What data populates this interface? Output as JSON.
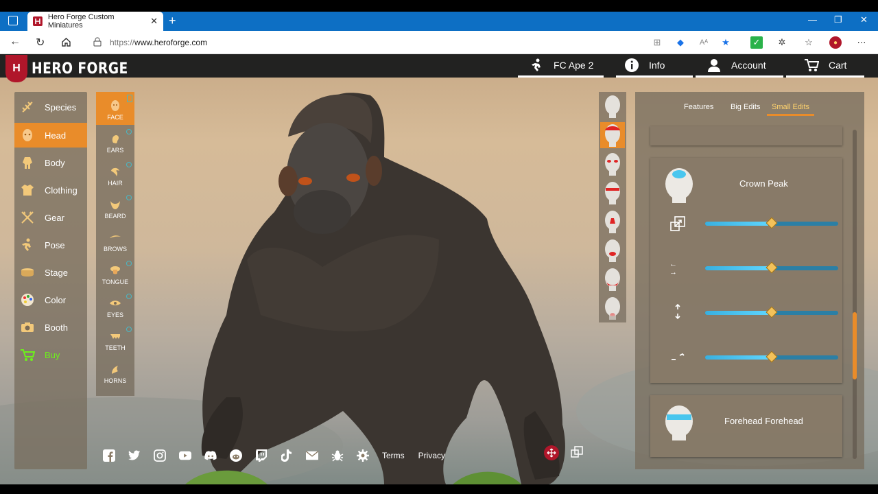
{
  "browser": {
    "tab_title": "Hero Forge Custom Miniatures",
    "new_tab": "+",
    "url_prefix": "https://",
    "url_domain": "www.heroforge.com",
    "minimize": "—",
    "maximize": "❐",
    "close": "✕"
  },
  "nav": {
    "logo": "HERO FORGE",
    "logo_mark": "H",
    "character_name": "FC Ape 2",
    "info": "Info",
    "account": "Account",
    "cart": "Cart"
  },
  "left_menu": [
    {
      "label": "Species",
      "icon": "dna-icon"
    },
    {
      "label": "Head",
      "icon": "head-icon",
      "active": true
    },
    {
      "label": "Body",
      "icon": "body-icon"
    },
    {
      "label": "Clothing",
      "icon": "shirt-icon"
    },
    {
      "label": "Gear",
      "icon": "axes-icon"
    },
    {
      "label": "Pose",
      "icon": "pose-icon"
    },
    {
      "label": "Stage",
      "icon": "stage-icon"
    },
    {
      "label": "Color",
      "icon": "palette-icon"
    },
    {
      "label": "Booth",
      "icon": "camera-icon"
    },
    {
      "label": "Buy",
      "icon": "cart-icon"
    }
  ],
  "sub_menu": [
    {
      "label": "FACE",
      "active": true
    },
    {
      "label": "EARS"
    },
    {
      "label": "HAIR"
    },
    {
      "label": "BEARD"
    },
    {
      "label": "BROWS"
    },
    {
      "label": "TONGUE"
    },
    {
      "label": "EYES"
    },
    {
      "label": "TEETH"
    },
    {
      "label": "HORNS"
    }
  ],
  "right_tabs": {
    "features": "Features",
    "big_edits": "Big Edits",
    "small_edits": "Small Edits"
  },
  "cards": {
    "crown": {
      "title": "Crown Peak",
      "sliders": [
        0.5,
        0.5,
        0.5,
        0.5
      ]
    },
    "forehead": {
      "title": "Forehead Forehead"
    }
  },
  "footer": {
    "terms": "Terms",
    "privacy": "Privacy"
  },
  "colors": {
    "accent": "#e98c2a",
    "buy": "#6cf21a",
    "brand": "#b0162a"
  }
}
